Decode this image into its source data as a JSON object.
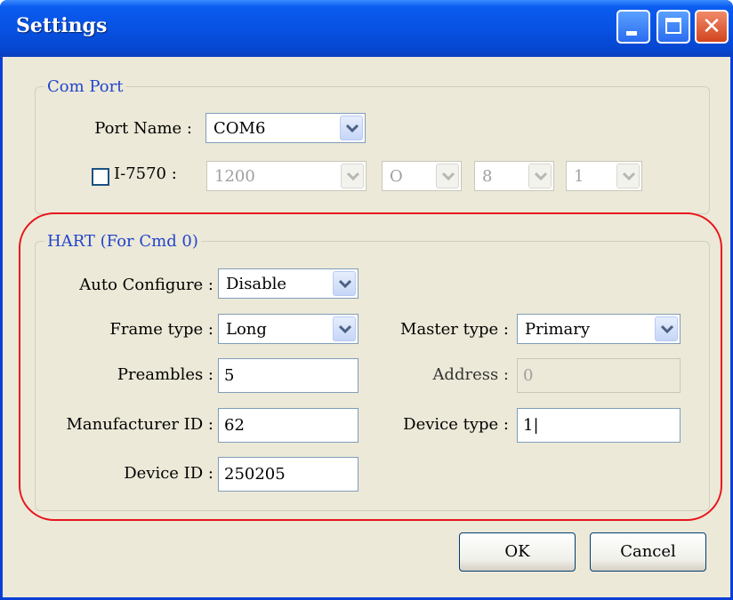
{
  "window": {
    "title": "Settings"
  },
  "com_port": {
    "legend": "Com Port",
    "port_name_label": "Port Name :",
    "port_name_value": "COM6",
    "i7570_label": "I-7570 :",
    "i7570_checked": false,
    "baud": "1200",
    "parity": "O",
    "data_bits": "8",
    "stop_bits": "1"
  },
  "hart": {
    "legend": "HART (For Cmd 0)",
    "auto_configure_label": "Auto Configure :",
    "auto_configure_value": "Disable",
    "frame_type_label": "Frame type :",
    "frame_type_value": "Long",
    "master_type_label": "Master type :",
    "master_type_value": "Primary",
    "preambles_label": "Preambles :",
    "preambles_value": "5",
    "address_label": "Address :",
    "address_value": "0",
    "manufacturer_id_label": "Manufacturer ID :",
    "manufacturer_id_value": "62",
    "device_type_label": "Device type :",
    "device_type_value": "1|",
    "device_id_label": "Device ID :",
    "device_id_value": "250205"
  },
  "buttons": {
    "ok": "OK",
    "cancel": "Cancel"
  },
  "colors": {
    "highlight_ring": "#e8141c",
    "legend_text": "#2244cc",
    "titlebar": "#0752e3"
  }
}
